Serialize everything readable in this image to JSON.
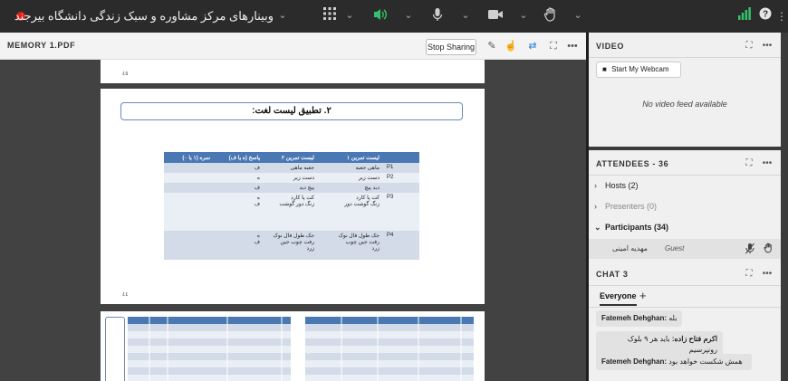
{
  "topbar": {
    "meeting_title": "وبینارهای مرکز مشاوره و سبک زندگی دانشگاه بیرجند",
    "icons": [
      "record-icon",
      "chevron-down-icon",
      "apps-grid-icon",
      "speaker-icon",
      "microphone-icon",
      "camera-icon",
      "raise-hand-icon",
      "signal-icon",
      "help-icon",
      "more-icon"
    ]
  },
  "share_pod": {
    "title": "MEMORY 1.PDF",
    "stop_sharing_label": "Stop Sharing",
    "tools": [
      "draw-icon",
      "pointer-icon",
      "sync-icon",
      "fullscreen-icon",
      "more-icon"
    ]
  },
  "document": {
    "prev_page_number": "٤٥",
    "page_number": "٤٤",
    "heading": "۲. تطبیق لیست لغت:",
    "table_headers": [
      "",
      "لیست تمرین ۱",
      "لیست تمرین ۲",
      "پاسخ (ه یا ف)",
      "نمره (۱ یا ۰)"
    ],
    "rows": [
      {
        "label": "P1",
        "list1": "ماهی جعبه",
        "list2": "جعبه ماهی",
        "answer": "ف",
        "score": ""
      },
      {
        "label": "P2",
        "list1": "دست زیر",
        "list2": "دست زیر",
        "answer": "ه",
        "score": ""
      },
      {
        "label": "",
        "list1": "دید پیچ",
        "list2": "پیچ دید",
        "answer": "ف",
        "score": ""
      },
      {
        "label": "P3",
        "list1": "کت پا کارد\nزنگ گوشت دور",
        "list2": "کت پا کارد\nزنگ دور گوشت",
        "answer": "ه\nف",
        "score": ""
      },
      {
        "label": "P4",
        "list1": "جک طول فال نوک\nرفت جین چوب\nزرد",
        "list2": "جک طول فال نوک\nرفت چوب جین\nزرد",
        "answer": "ه\nف",
        "score": ""
      }
    ]
  },
  "video_panel": {
    "title": "VIDEO",
    "webcam_button": "Start My Webcam",
    "empty_text": "No video feed available"
  },
  "attendees_panel": {
    "title": "ATTENDEES",
    "count": "- 36",
    "hosts": "Hosts (2)",
    "presenters": "Presenters (0)",
    "participants": "Participants (34)",
    "participant_name": "مهدیه امینی",
    "participant_role": "Guest"
  },
  "chat_panel": {
    "title": "CHAT",
    "count": "3",
    "tab_everyone": "Everyone",
    "add_tab": "+",
    "messages": [
      {
        "sender": "Fatemeh Dehghan:",
        "text": "بله"
      },
      {
        "sender": "اکرم فتاح زاده:",
        "text": "باید هر ۹ بلوک رونپرسیم"
      },
      {
        "sender": "Fatemeh Dehghan:",
        "text": "همش شکست خواهد بود"
      }
    ]
  },
  "colors": {
    "topbar_bg": "#2b2b2b",
    "table_header": "#4a78b3",
    "record": "#e2231a",
    "speaker_active": "#34c06a",
    "signal": "#34c06a"
  }
}
